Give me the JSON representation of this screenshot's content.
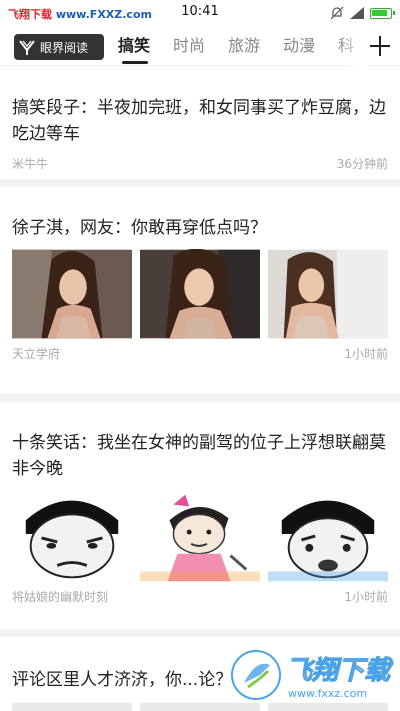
{
  "status_bar": {
    "watermark_red": "飞翔下载",
    "watermark_url": "www.FXXZ.com",
    "time": "10:41"
  },
  "nav": {
    "logo_text": "眼界阅读",
    "tabs": [
      "搞笑",
      "时尚",
      "旅游",
      "动漫",
      "科"
    ],
    "active_tab": "搞笑"
  },
  "articles": [
    {
      "title": "搞笑段子：半夜加完班，和女同事买了炸豆腐，边吃边等车",
      "source": "米牛牛",
      "time": "36分钟前"
    },
    {
      "title": "徐子淇，网友：你敢再穿低点吗？",
      "source": "天立学府",
      "time": "1小时前"
    },
    {
      "title": "十条笑话：我坐在女神的副驾的位子上浮想联翩莫非今晚",
      "source": "将姑娘的幽默时刻",
      "time": "1小时前"
    },
    {
      "title": "评论区里人才济济，你...论？",
      "source": "",
      "time": ""
    }
  ],
  "watermark_bottom": {
    "title": "飞翔下载",
    "url": "www.fxxz.com"
  },
  "colors": {
    "accent": "#222222",
    "watermark_red": "#e0242c",
    "watermark_blue": "#4aa3e6"
  }
}
